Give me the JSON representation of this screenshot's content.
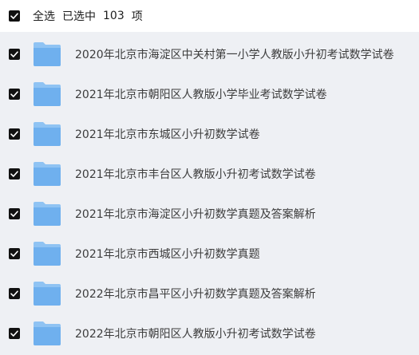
{
  "header": {
    "select_all_label": "全选",
    "selected_prefix": "已选中",
    "selected_count": "103",
    "selected_unit": "项"
  },
  "items": [
    {
      "label": "2020年北京市海淀区中关村第一小学人教版小升初考试数学试卷",
      "checked": true
    },
    {
      "label": "2021年北京市朝阳区人教版小学毕业考试数学试卷",
      "checked": true
    },
    {
      "label": "2021年北京市东城区小升初数学试卷",
      "checked": true
    },
    {
      "label": "2021年北京市丰台区人教版小升初考试数学试卷",
      "checked": true
    },
    {
      "label": "2021年北京市海淀区小升初数学真题及答案解析",
      "checked": true
    },
    {
      "label": "2021年北京市西城区小升初数学真题",
      "checked": true
    },
    {
      "label": "2022年北京市昌平区小升初数学真题及答案解析",
      "checked": true
    },
    {
      "label": "2022年北京市朝阳区人教版小升初考试数学试卷",
      "checked": true
    }
  ],
  "colors": {
    "checkbox": "#111111",
    "folder_back": "#8fc3f3",
    "folder_front": "#6fb0ee",
    "background": "#eef0f4"
  },
  "icons": {
    "checkbox": "checkbox-checked-icon",
    "folder": "folder-icon"
  }
}
